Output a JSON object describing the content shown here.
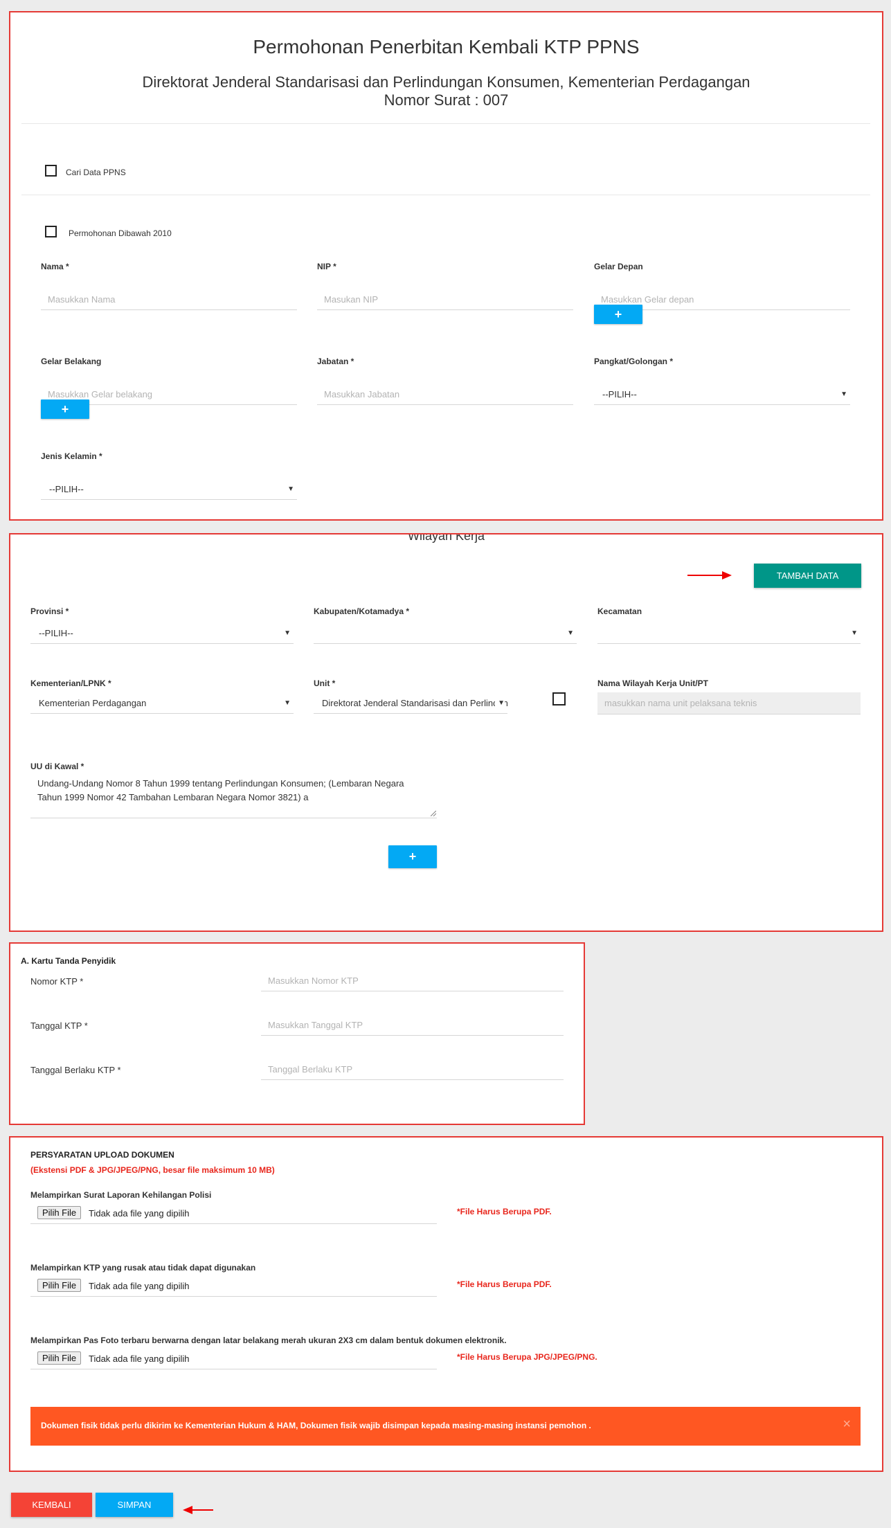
{
  "header": {
    "title": "Permohonan Penerbitan Kembali KTP PPNS",
    "subtitle": "Direktorat Jenderal Standarisasi dan Perlindungan Konsumen, Kementerian Perdagangan",
    "letter_number": "Nomor Surat : 007"
  },
  "personal": {
    "cari_data_label": "Cari Data PPNS",
    "dibawah_2010_label": "Permohonan Dibawah 2010",
    "nama_label": "Nama *",
    "nama_placeholder": "Masukkan Nama",
    "nip_label": "NIP *",
    "nip_placeholder": "Masukan NIP",
    "gelar_depan_label": "Gelar Depan",
    "gelar_depan_placeholder": "Masukkan Gelar depan",
    "gelar_belakang_label": "Gelar Belakang",
    "gelar_belakang_placeholder": "Masukkan Gelar belakang",
    "jabatan_label": "Jabatan *",
    "jabatan_placeholder": "Masukkan Jabatan",
    "pangkat_label": "Pangkat/Golongan *",
    "pangkat_value": "--PILIH--",
    "jenis_kelamin_label": "Jenis Kelamin *",
    "jenis_kelamin_value": "--PILIH--",
    "plus": "+"
  },
  "wilayah": {
    "title": "Wilayah Kerja",
    "tambah_button": "TAMBAH DATA",
    "provinsi_label": "Provinsi *",
    "provinsi_value": "--PILIH--",
    "kabupaten_label": "Kabupaten/Kotamadya *",
    "kabupaten_value": "",
    "kecamatan_label": "Kecamatan",
    "kecamatan_value": "",
    "kementerian_label": "Kementerian/LPNK *",
    "kementerian_value": "Kementerian Perdagangan",
    "unit_label": "Unit *",
    "unit_value": "Direktorat Jenderal Standarisasi dan Perlindungan Konsumen",
    "nama_wilayah_label": "Nama Wilayah Kerja Unit/PT",
    "nama_wilayah_placeholder": "masukkan nama unit pelaksana teknis",
    "uu_label": "UU di Kawal *",
    "uu_value": "Undang-Undang Nomor 8 Tahun 1999 tentang Perlindungan Konsumen; (Lembaran Negara Tahun 1999 Nomor 42 Tambahan Lembaran Negara Nomor 3821) a",
    "plus": "+"
  },
  "ktp": {
    "section_title": "A. Kartu Tanda Penyidik",
    "nomor_label": "Nomor KTP *",
    "nomor_placeholder": "Masukkan Nomor KTP",
    "tanggal_label": "Tanggal KTP *",
    "tanggal_placeholder": "Masukkan Tanggal KTP",
    "berlaku_label": "Tanggal Berlaku KTP *",
    "berlaku_placeholder": "Tanggal Berlaku KTP"
  },
  "upload": {
    "title": "PERSYARATAN UPLOAD DOKUMEN",
    "note": "(Ekstensi PDF & JPG/JPEG/PNG, besar file maksimum 10 MB)",
    "items": [
      {
        "label": "Melampirkan Surat Laporan Kehilangan Polisi",
        "button": "Pilih File",
        "status": "Tidak ada file yang dipilih",
        "hint": "*File Harus Berupa PDF."
      },
      {
        "label": "Melampirkan KTP yang rusak atau tidak dapat digunakan",
        "button": "Pilih File",
        "status": "Tidak ada file yang dipilih",
        "hint": "*File Harus Berupa PDF."
      },
      {
        "label": "Melampirkan Pas Foto terbaru berwarna dengan latar belakang merah ukuran 2X3 cm dalam bentuk dokumen elektronik.",
        "button": "Pilih File",
        "status": "Tidak ada file yang dipilih",
        "hint": "*File Harus Berupa JPG/JPEG/PNG."
      }
    ],
    "alert": "Dokumen fisik tidak perlu dikirim ke Kementerian Hukum & HAM, Dokumen fisik wajib disimpan kepada masing-masing instansi pemohon .",
    "alert_close": "×"
  },
  "actions": {
    "kembali": "KEMBALI",
    "simpan": "SIMPAN"
  },
  "colors": {
    "accent_blue": "#03a9f4",
    "teal": "#009688",
    "alert_orange": "#ff5722",
    "back_red": "#f44336",
    "border_red": "#e53935"
  }
}
